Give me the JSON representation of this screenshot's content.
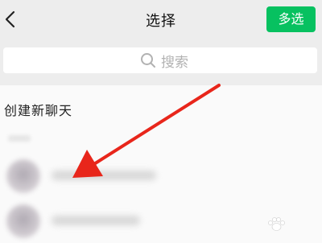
{
  "header": {
    "title": "选择",
    "multi_select_label": "多选",
    "back_icon": "chevron-left-icon"
  },
  "search": {
    "placeholder": "搜索",
    "icon": "search-icon"
  },
  "list": {
    "new_chat_label": "创建新聊天"
  },
  "annotation": {
    "color": "#e8261b"
  },
  "colors": {
    "accent": "#07c160",
    "background": "#ededed"
  }
}
